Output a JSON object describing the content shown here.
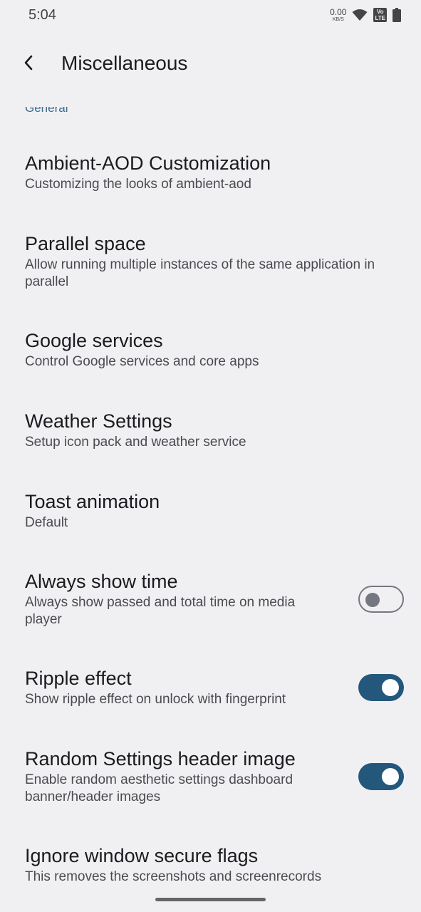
{
  "status_bar": {
    "time": "5:04",
    "net_speed_value": "0.00",
    "net_speed_unit": "KB/S",
    "volte_top": "Vo",
    "volte_bottom": "LTE"
  },
  "app_bar": {
    "title": "Miscellaneous"
  },
  "partial_category": "General",
  "items": [
    {
      "title": "Ambient-AOD Customization",
      "summary": "Customizing the looks of ambient-aod"
    },
    {
      "title": "Parallel space",
      "summary": "Allow running multiple instances of the same application in parallel"
    },
    {
      "title": "Google services",
      "summary": "Control Google services and core apps"
    },
    {
      "title": "Weather Settings",
      "summary": "Setup icon pack and weather service"
    },
    {
      "title": "Toast animation",
      "summary": "Default"
    },
    {
      "title": "Always show time",
      "summary": "Always show passed and total time on media player",
      "switch_on": false
    },
    {
      "title": "Ripple effect",
      "summary": "Show ripple effect on unlock with fingerprint",
      "switch_on": true
    },
    {
      "title": "Random Settings header image",
      "summary": "Enable random aesthetic settings dashboard banner/header images",
      "switch_on": true
    },
    {
      "title": "Ignore window secure flags",
      "summary": "This removes the screenshots and screenrecords"
    }
  ],
  "colors": {
    "background": "#f0f0f3",
    "accent": "#23587c",
    "switch_off": "#74777f",
    "category_text": "#3c6c8c"
  },
  "icons": [
    "wifi-icon",
    "battery-icon",
    "back-arrow-icon"
  ]
}
